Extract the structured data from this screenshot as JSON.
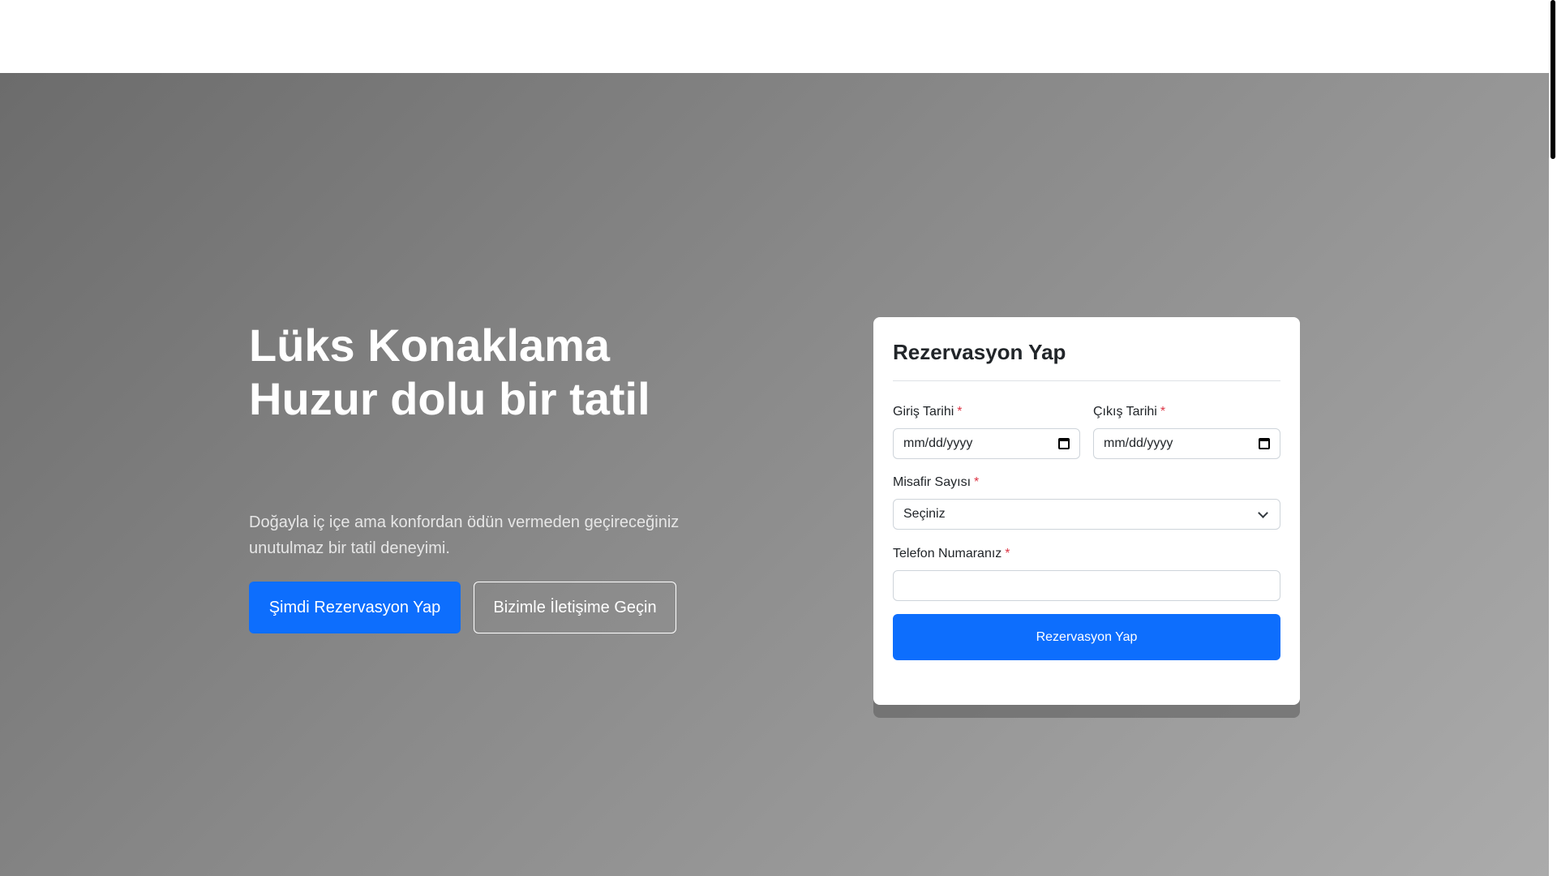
{
  "hero": {
    "title_line1": "Lüks Konaklama",
    "title_line2": "Huzur dolu bir tatil",
    "subtitle": "Doğayla iç içe ama konfordan ödün vermeden geçireceğiniz unutulmaz bir tatil deneyimi.",
    "primary_button": "Şimdi Rezervasyon Yap",
    "secondary_button": "Bizimle İletişime Geçin"
  },
  "reservation": {
    "title": "Rezervasyon Yap",
    "checkin_label": "Giriş Tarihi",
    "checkin_value": "mm/dd/yyyy",
    "checkout_label": "Çıkış Tarihi",
    "checkout_value": "mm/dd/yyyy",
    "guests_label": "Misafir Sayısı",
    "guests_value": "Seçiniz",
    "phone_label": "Telefon Numaranız",
    "phone_value": "",
    "required_marker": "*",
    "submit_label": "Rezervasyon Yap"
  },
  "colors": {
    "primary": "#0d6efd",
    "required": "#dc3545"
  },
  "icons": {
    "date_picker": "calendar-icon",
    "select": "chevron-down-icon"
  }
}
